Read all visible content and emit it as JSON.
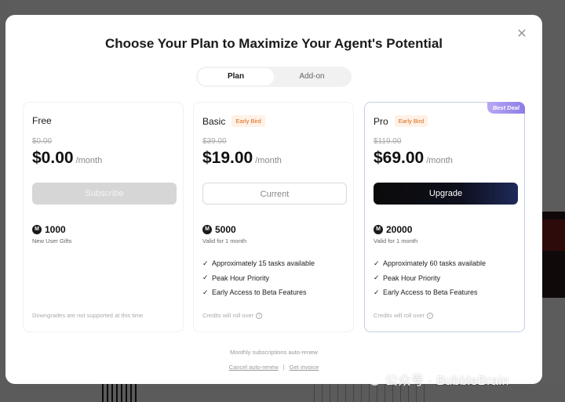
{
  "modal": {
    "title": "Choose Your Plan to Maximize Your Agent's Potential",
    "close_icon": "close-icon",
    "tabs": [
      {
        "label": "Plan",
        "active": true
      },
      {
        "label": "Add-on",
        "active": false
      }
    ]
  },
  "plans": [
    {
      "name": "Free",
      "old_price": "$0.00",
      "price": "$0.00",
      "period": "/month",
      "cta": "Subscribe",
      "credits": "1000",
      "credits_note": "New User Gifts",
      "footer": "Downgrades are not supported at this time"
    },
    {
      "name": "Basic",
      "badge": "Early Bird",
      "old_price": "$39.00",
      "price": "$19.00",
      "period": "/month",
      "cta": "Current",
      "credits": "5000",
      "credits_note": "Valid for 1 month",
      "features": [
        "Approximately 15 tasks available",
        "Peak Hour Priority",
        "Early Access to Beta Features"
      ],
      "footer": "Credits will roll over"
    },
    {
      "name": "Pro",
      "badge": "Early Bird",
      "corner_badge": "Best Deal",
      "old_price": "$119.00",
      "price": "$69.00",
      "period": "/month",
      "cta": "Upgrade",
      "credits": "20000",
      "credits_note": "Valid for 1 month",
      "features": [
        "Approximately 60 tasks available",
        "Peak Hour Priority",
        "Early Access to Beta Features"
      ],
      "footer": "Credits will roll over"
    }
  ],
  "footer": {
    "auto_renew": "Monthly subscriptions auto-renew",
    "cancel_link": "Cancel auto-renew",
    "separator": "|",
    "invoice_link": "Get invoice"
  },
  "watermark": "公众号 · BubbleBrain",
  "credit_icon_letter": "M",
  "colors": {
    "badge_text": "#d86a1a",
    "badge_bg": "#fff1e6",
    "pro_border": "#c7cfe6",
    "upgrade_button": "#0b0b0b",
    "best_deal": "#8c7de8"
  }
}
